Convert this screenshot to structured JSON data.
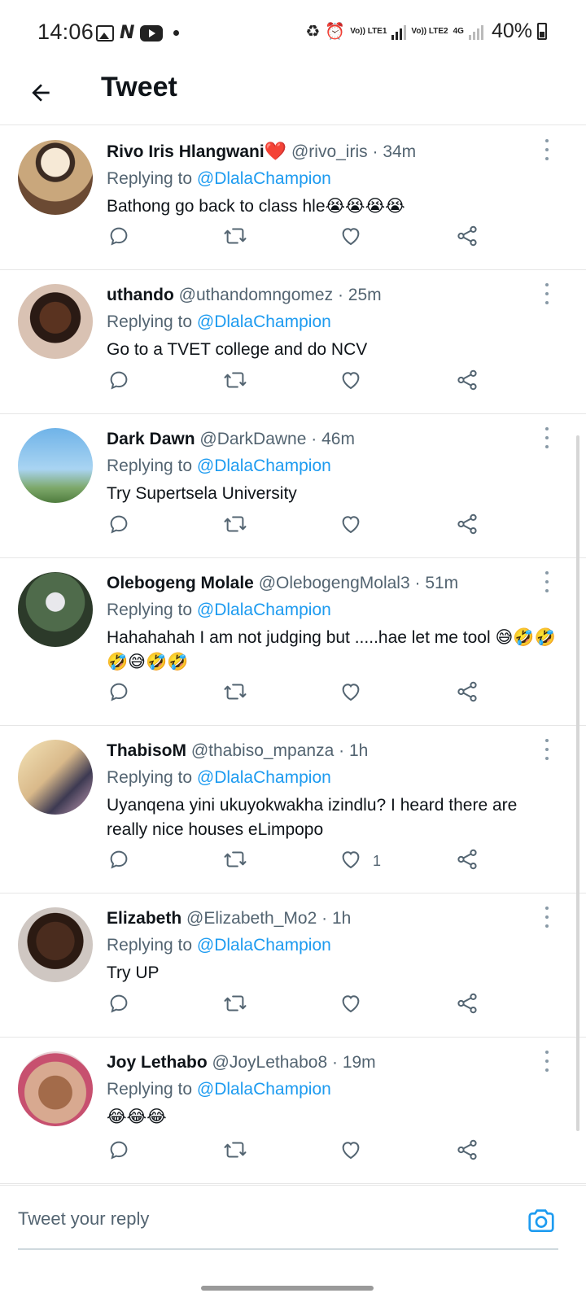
{
  "status_bar": {
    "time": "14:06",
    "lte1": "Vo)) LTE1",
    "lte2": "Vo)) LTE2",
    "net": "4G",
    "battery": "40%"
  },
  "header": {
    "title": "Tweet"
  },
  "accent_color": "#1d9bf0",
  "tweets": [
    {
      "name": "Rivo Iris Hlangwani",
      "badge": "❤️",
      "handle": "@rivo_iris",
      "time": "34m",
      "replying_prefix": "Replying to",
      "replying_to": "@DlalaChampion",
      "text": "Bathong go back to class hle😭😭😭😭",
      "likes": ""
    },
    {
      "name": "uthando",
      "handle": "@uthandomngomez",
      "time": "25m",
      "replying_prefix": "Replying to",
      "replying_to": "@DlalaChampion",
      "text": "Go to a TVET college and do NCV",
      "likes": ""
    },
    {
      "name": "Dark Dawn",
      "handle": "@DarkDawne",
      "time": "46m",
      "replying_prefix": "Replying to",
      "replying_to": "@DlalaChampion",
      "text": "Try Supertsela University",
      "likes": ""
    },
    {
      "name": "Olebogeng Molale",
      "handle": "@OlebogengMolal3",
      "time": "51m",
      "replying_prefix": "Replying to",
      "replying_to": "@DlalaChampion",
      "text": "Hahahahah I am not judging but .....hae let me tool 😅🤣🤣🤣😅🤣🤣",
      "likes": ""
    },
    {
      "name": "ThabisoM",
      "handle": "@thabiso_mpanza",
      "time": "1h",
      "replying_prefix": "Replying to",
      "replying_to": "@DlalaChampion",
      "text": "Uyanqena yini ukuyokwakha izindlu? I heard there are really nice houses eLimpopo",
      "likes": "1"
    },
    {
      "name": "Elizabeth",
      "handle": "@Elizabeth_Mo2",
      "time": "1h",
      "replying_prefix": "Replying to",
      "replying_to": "@DlalaChampion",
      "text": "Try UP",
      "likes": ""
    },
    {
      "name": "Joy Lethabo",
      "handle": "@JoyLethabo8",
      "time": "19m",
      "replying_prefix": "Replying to",
      "replying_to": "@DlalaChampion",
      "text": "😂😂😂",
      "likes": ""
    }
  ],
  "reply_bar": {
    "placeholder": "Tweet your reply"
  }
}
